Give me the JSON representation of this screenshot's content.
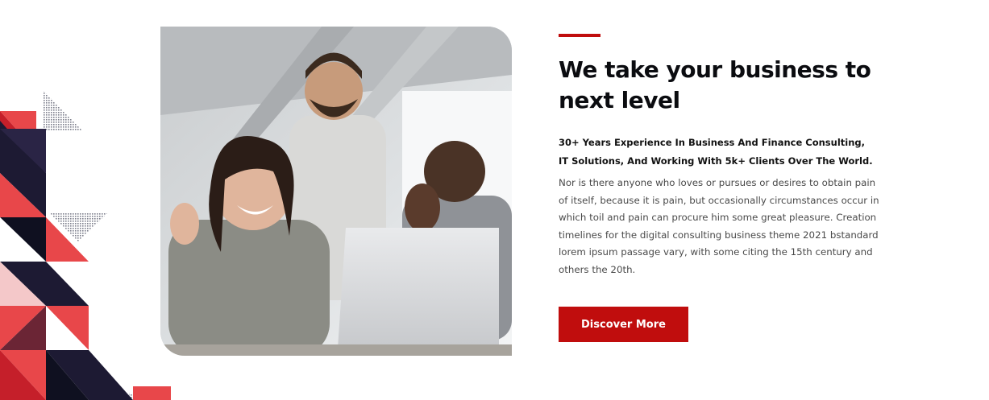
{
  "about": {
    "heading": "We take your business to next level",
    "subheading": "30+ Years Experience In Business And Finance Consulting, IT Solutions, And Working With 5k+ Clients Over The World.",
    "body": "Nor is there anyone who loves or pursues or desires to obtain pain of itself, because it is pain, but occasionally circumstances occur in which toil and pain can procure him some great pleasure. Creation timelines for the digital consulting business theme 2021 bstandard lorem ipsum passage vary, with some citing the 15th century and others the 20th.",
    "button_label": "Discover More",
    "image_subject": "three colleagues laughing around a laptop"
  },
  "colors": {
    "accent": "#c00d0d",
    "heading": "#0b0c10",
    "body": "#4a4a4a",
    "navy": "#1d1a33",
    "light_red": "#e8474a"
  }
}
